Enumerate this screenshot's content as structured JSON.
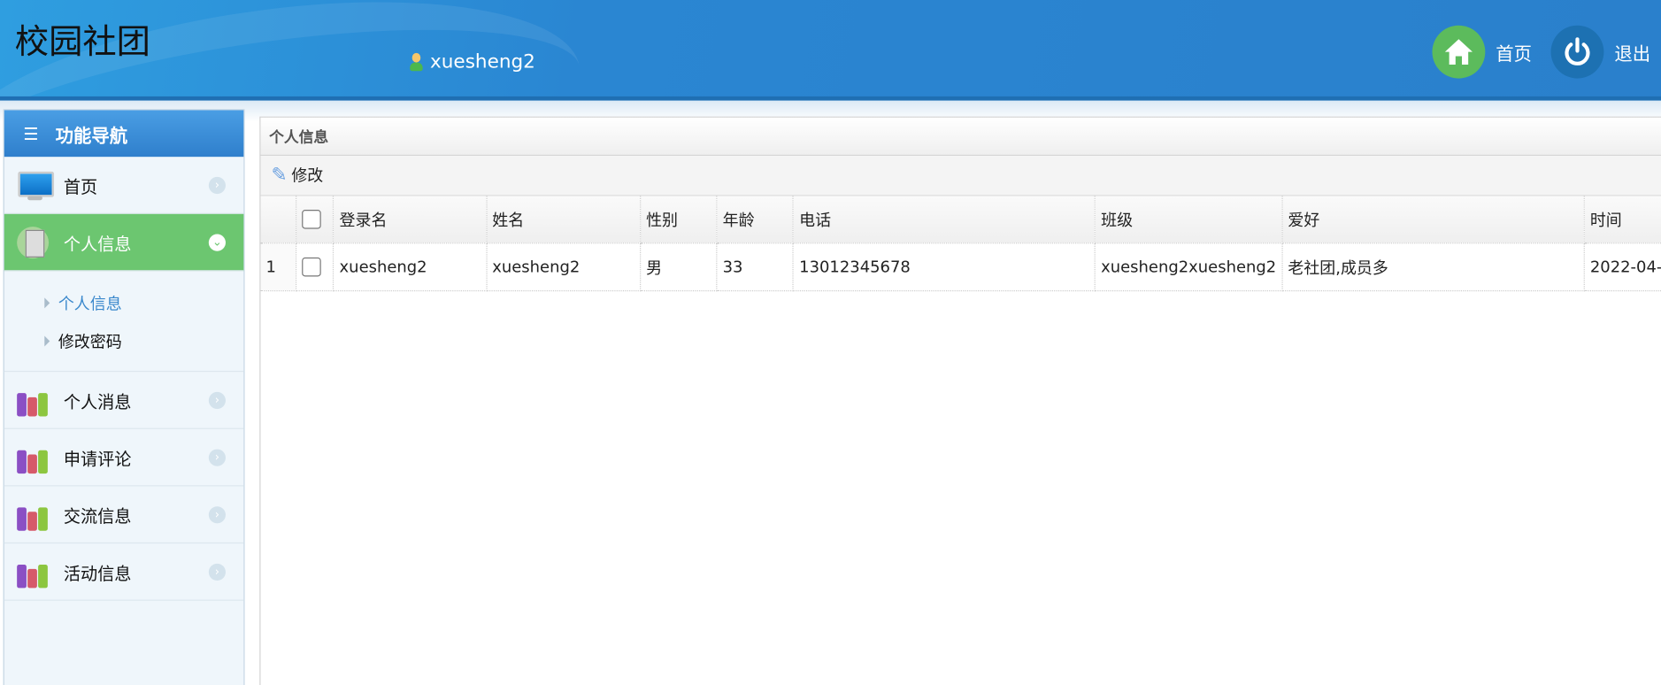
{
  "header": {
    "title": "校园社团",
    "username": "xuesheng2",
    "home_label": "首页",
    "logout_label": "退出"
  },
  "sidebar": {
    "title": "功能导航",
    "items": [
      {
        "label": "首页"
      },
      {
        "label": "个人信息",
        "children": [
          {
            "label": "个人信息"
          },
          {
            "label": "修改密码"
          }
        ]
      },
      {
        "label": "个人消息"
      },
      {
        "label": "申请评论"
      },
      {
        "label": "交流信息"
      },
      {
        "label": "活动信息"
      }
    ]
  },
  "panel": {
    "title": "个人信息",
    "edit_label": "修改",
    "columns": [
      "登录名",
      "姓名",
      "性别",
      "年龄",
      "电话",
      "班级",
      "爱好",
      "时间"
    ],
    "rows": [
      {
        "index": "1",
        "cells": [
          "xuesheng2",
          "xuesheng2",
          "男",
          "33",
          "13012345678",
          "xuesheng2xuesheng2",
          "老社团,成员多",
          "2022-04-"
        ]
      }
    ]
  },
  "colors": {
    "header": "#2a86d2",
    "active": "#6cc670",
    "link": "#3a88cc"
  }
}
